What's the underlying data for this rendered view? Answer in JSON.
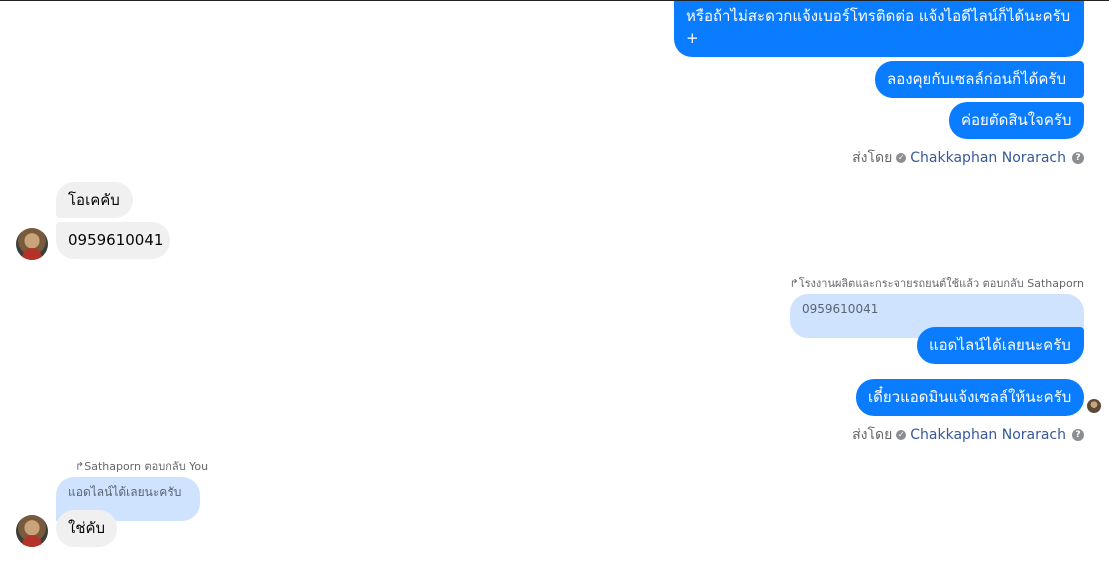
{
  "messages": {
    "out1": {
      "line1": "หรือถ้าไม่สะดวกแจ้งเบอร์โทรติดต่อ แจ้งไอดีไลน์ก็ได้นะครับ",
      "line2": "+"
    },
    "out2": "ลองคุยกับเซลล์ก่อนก็ได้ครับ",
    "out3": "ค่อยตัดสินใจครับ",
    "sent_by_1": {
      "label": "ส่งโดย",
      "name": "Chakkaphan Norarach"
    },
    "in1": "โอเคคับ",
    "in2": "0959610041",
    "reply_label_1": "โรงงานผลิตและกระจายรถยนต์ใช้แล้ว ตอบกลับ Sathaporn",
    "quote_1": "0959610041",
    "out4": "แอดไลน์ได้เลยนะครับ",
    "out5": "เดี๋ยวแอดมินแจ้งเซลล์ให้นะครับ",
    "sent_by_2": {
      "label": "ส่งโดย",
      "name": "Chakkaphan Norarach"
    },
    "reply_label_2": "Sathaporn ตอบกลับ You",
    "quote_2": "แอดไลน์ได้เลยนะครับ",
    "in3": "ใช่คับ"
  },
  "icons": {
    "verified": "check-circle-icon",
    "help": "question-circle-icon",
    "reply": "reply-arrow-icon"
  },
  "colors": {
    "outgoing_bubble": "#0a7cff",
    "incoming_bubble": "#f0f0f0",
    "quote_bubble": "#cfe3ff",
    "link_name": "#385898"
  }
}
